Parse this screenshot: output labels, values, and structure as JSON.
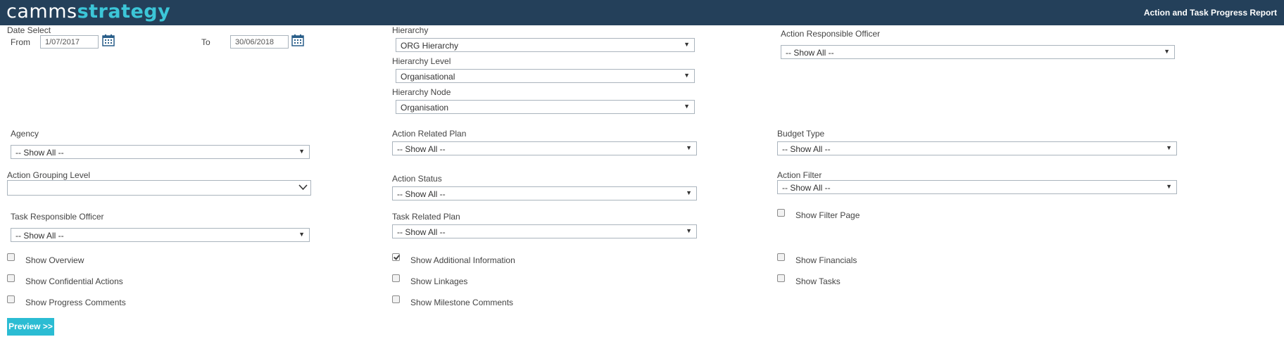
{
  "header": {
    "logo_part1": "camms",
    "logo_part2": "strategy",
    "report_title": "Action and Task Progress Report"
  },
  "date_select": {
    "label": "Date Select",
    "from_label": "From",
    "from_value": "1/07/2017",
    "to_label": "To",
    "to_value": "30/06/2018"
  },
  "hierarchy": {
    "label": "Hierarchy",
    "value": "ORG Hierarchy",
    "level_label": "Hierarchy Level",
    "level_value": "Organisational",
    "node_label": "Hierarchy Node",
    "node_value": "Organisation"
  },
  "filters": {
    "action_responsible_officer": {
      "label": "Action Responsible Officer",
      "value": "-- Show All --"
    },
    "agency": {
      "label": "Agency",
      "value": "-- Show All --"
    },
    "action_related_plan": {
      "label": "Action Related Plan",
      "value": "-- Show All --"
    },
    "budget_type": {
      "label": "Budget Type",
      "value": "-- Show All --"
    },
    "action_grouping_level": {
      "label": "Action Grouping Level",
      "value": ""
    },
    "action_status": {
      "label": "Action Status",
      "value": "-- Show All --"
    },
    "action_filter": {
      "label": "Action Filter",
      "value": "-- Show All --"
    },
    "task_responsible_officer": {
      "label": "Task Responsible Officer",
      "value": "-- Show All --"
    },
    "task_related_plan": {
      "label": "Task Related Plan",
      "value": "-- Show All --"
    }
  },
  "checkboxes": {
    "show_filter_page": {
      "label": "Show Filter Page",
      "checked": false
    },
    "show_overview": {
      "label": "Show Overview",
      "checked": false
    },
    "show_additional_information": {
      "label": "Show Additional Information",
      "checked": true
    },
    "show_financials": {
      "label": "Show Financials",
      "checked": false
    },
    "show_confidential_actions": {
      "label": "Show Confidential Actions",
      "checked": false
    },
    "show_linkages": {
      "label": "Show Linkages",
      "checked": false
    },
    "show_tasks": {
      "label": "Show Tasks",
      "checked": false
    },
    "show_progress_comments": {
      "label": "Show Progress Comments",
      "checked": false
    },
    "show_milestone_comments": {
      "label": "Show Milestone Comments",
      "checked": false
    }
  },
  "preview_button": "Preview >>",
  "icons": {
    "calendar": "calendar-icon",
    "dropdown": "chevron-down-icon"
  }
}
